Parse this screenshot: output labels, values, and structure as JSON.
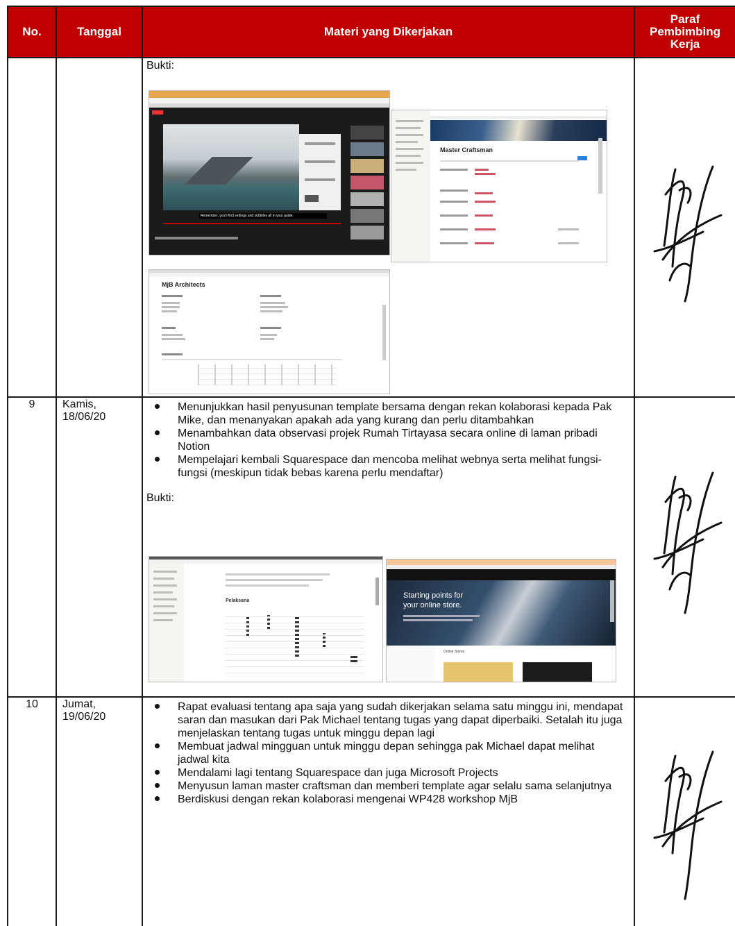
{
  "table": {
    "headers": {
      "no": "No.",
      "tanggal": "Tanggal",
      "materi": "Materi yang Dikerjakan",
      "paraf": [
        "Paraf",
        "Pembimbing",
        "Kerja"
      ]
    },
    "rows": [
      {
        "no": "",
        "tanggal": [],
        "activities": [],
        "bukti_label": "Bukti:",
        "screenshots": [
          {
            "name": "youtube-video-screenshot",
            "caption": "Remember, you'll find settings and subtitles all in your guide."
          },
          {
            "name": "notion-master-craftsman-screenshot",
            "title": "Master Craftsman"
          },
          {
            "name": "notion-mjb-architects-screenshot",
            "title": "MjB Architects"
          }
        ]
      },
      {
        "no": "9",
        "tanggal": [
          "Kamis,",
          "18/06/20"
        ],
        "activities": [
          "Menunjukkan hasil penyusunan template bersama dengan rekan kolaborasi kepada Pak Mike, dan menanyakan apakah ada yang kurang dan perlu ditambahkan",
          "Menambahkan data observasi projek Rumah Tirtayasa secara online di laman pribadi Notion",
          "Mempelajari kembali Squarespace dan mencoba melihat webnya serta melihat fungsi-fungsi (meskipun tidak bebas karena perlu mendaftar)"
        ],
        "bukti_label": "Bukti:",
        "screenshots": [
          {
            "name": "notion-observation-table-screenshot",
            "title": "Pelaksana"
          },
          {
            "name": "squarespace-store-screenshot",
            "headline_1": "Starting points for",
            "headline_2": "your online store.",
            "section": "Online Stores"
          }
        ]
      },
      {
        "no": "10",
        "tanggal": [
          "Jumat,",
          "19/06/20"
        ],
        "activities": [
          "Rapat evaluasi tentang apa saja yang sudah dikerjakan selama satu minggu ini, mendapat saran dan masukan dari Pak Michael tentang tugas yang dapat diperbaiki. Setalah itu juga menjelaskan tentang tugas untuk minggu depan lagi",
          "Membuat jadwal mingguan untuk minggu depan sehingga pak Michael dapat melihat jadwal kita",
          "Mendalami lagi tentang Squarespace dan juga Microsoft Projects",
          "Menyusun laman master craftsman dan memberi template agar selalu sama selanjutnya",
          "Berdiskusi dengan rekan kolaborasi mengenai WP428 workshop MjB"
        ]
      }
    ]
  },
  "colors": {
    "header_bg": "#c00000",
    "header_text": "#ffffff",
    "border": "#1a1a1a"
  }
}
